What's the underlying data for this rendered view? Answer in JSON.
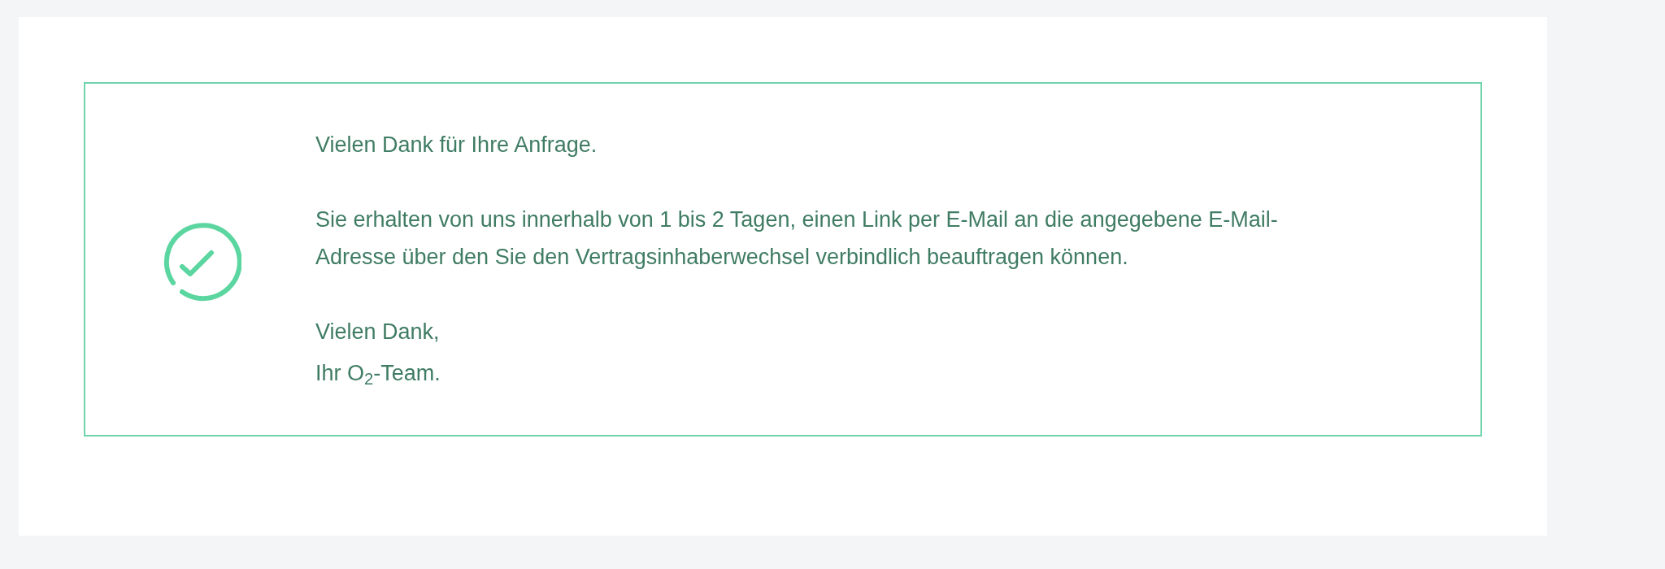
{
  "confirmation": {
    "heading": "Vielen Dank für Ihre Anfrage.",
    "message_lines": [
      "Sie erhalten von uns innerhalb von 1 bis 2 Tagen, einen Link per E-Mail an die angegebene E-Mail-",
      "Adresse über den Sie den Vertragsinhaberwechsel verbindlich beauftragen können."
    ],
    "closing": "Vielen Dank,",
    "signature": "Ihr O$_{2}$-Team."
  }
}
